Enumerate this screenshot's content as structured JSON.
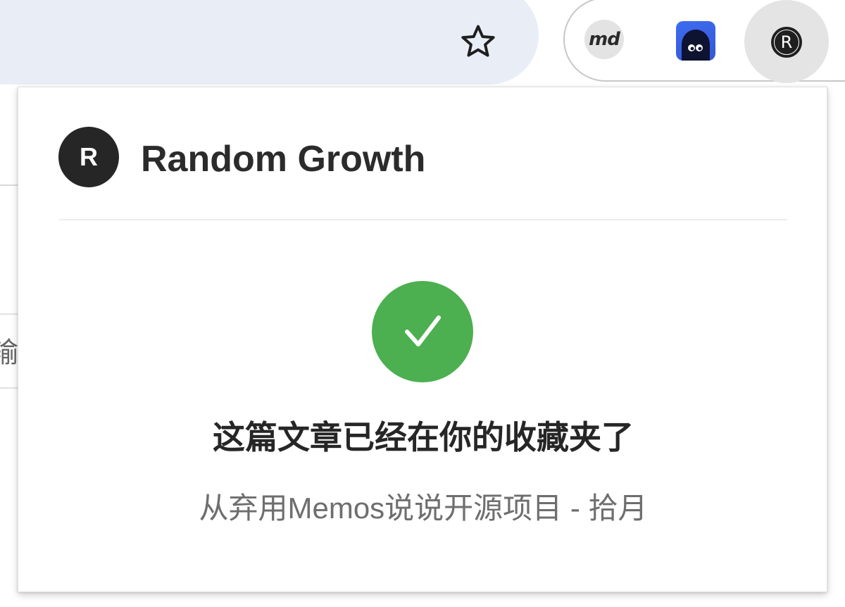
{
  "toolbar": {
    "bookmark_icon": "star-outline-icon",
    "extensions": [
      {
        "name": "markdown-extension",
        "label": "md"
      },
      {
        "name": "monster-extension",
        "icon": "monster-icon"
      }
    ],
    "profile": {
      "initial": "R"
    }
  },
  "background": {
    "partial_glyph": "输"
  },
  "popup": {
    "site_initial": "R",
    "site_name": "Random Growth",
    "success_icon": "check-icon",
    "success_color": "#4caf50",
    "message": "这篇文章已经在你的收藏夹了",
    "article_title": "从弃用Memos说说开源项目 - 拾月"
  }
}
